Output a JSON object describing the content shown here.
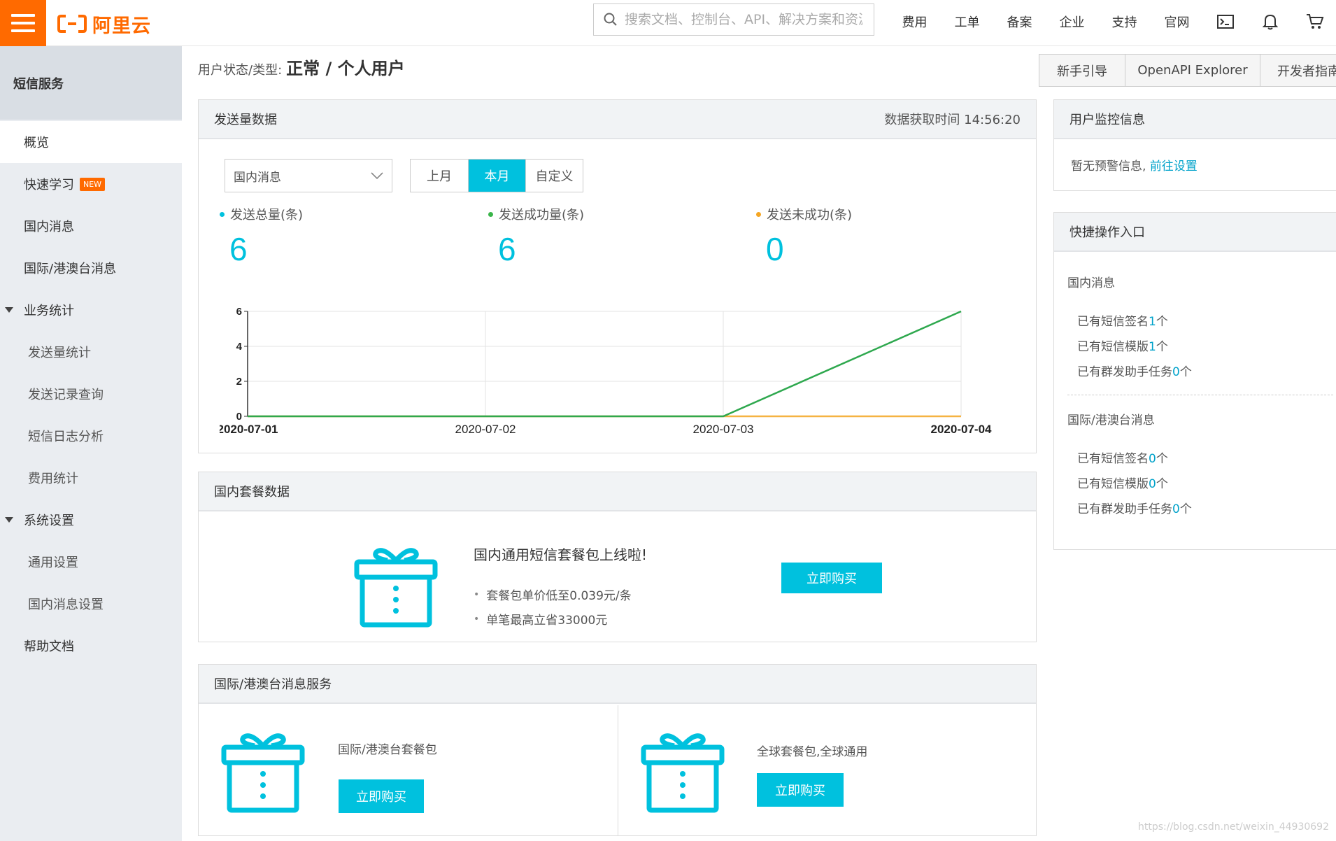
{
  "topbar": {
    "logo_text": "阿里云",
    "search_placeholder": "搜索文档、控制台、API、解决方案和资源",
    "nav": [
      "费用",
      "工单",
      "备案",
      "企业",
      "支持",
      "官网"
    ]
  },
  "sidebar": {
    "title": "短信服务",
    "items": [
      {
        "label": "概览"
      },
      {
        "label": "快速学习",
        "badge": "NEW"
      },
      {
        "label": "国内消息"
      },
      {
        "label": "国际/港澳台消息"
      },
      {
        "label": "业务统计"
      },
      {
        "label": "发送量统计"
      },
      {
        "label": "发送记录查询"
      },
      {
        "label": "短信日志分析"
      },
      {
        "label": "费用统计"
      },
      {
        "label": "系统设置"
      },
      {
        "label": "通用设置"
      },
      {
        "label": "国内消息设置"
      },
      {
        "label": "帮助文档"
      }
    ]
  },
  "user_status": {
    "label": "用户状态/类型:",
    "value": "正常 / 个人用户"
  },
  "guide_buttons": [
    "新手引导",
    "OpenAPI Explorer",
    "开发者指南"
  ],
  "send_panel": {
    "title": "发送量数据",
    "fetch_time": "数据获取时间 14:56:20",
    "select_value": "国内消息",
    "segments": [
      "上月",
      "本月",
      "自定义"
    ],
    "active_segment": "本月",
    "stats": [
      {
        "label": "发送总量(条)",
        "value": "6",
        "color": "#00c1de"
      },
      {
        "label": "发送成功量(条)",
        "value": "6",
        "color": "#3ab54a"
      },
      {
        "label": "发送未成功(条)",
        "value": "0",
        "color": "#f5a623"
      }
    ]
  },
  "chart_data": {
    "type": "line",
    "x": [
      "2020-07-01",
      "2020-07-02",
      "2020-07-03",
      "2020-07-04"
    ],
    "series": [
      {
        "values": [
          0,
          0,
          0,
          6
        ],
        "color": "#2ea84e"
      },
      {
        "values": [
          0,
          0,
          0,
          0
        ],
        "color": "#f5b342"
      }
    ],
    "yticks": [
      0,
      2,
      4,
      6
    ],
    "ylim": [
      0,
      6
    ],
    "grid": true
  },
  "package_panel": {
    "title": "国内套餐数据",
    "promo_title": "国内通用短信套餐包上线啦!",
    "bullets": [
      "套餐包单价低至0.039元/条",
      "单笔最高立省33000元"
    ],
    "buy_label": "立即购买"
  },
  "intl_panel": {
    "title": "国际/港澳台消息服务",
    "cards": [
      {
        "label": "国际/港澳台套餐包",
        "buy_label": "立即购买"
      },
      {
        "label": "全球套餐包,全球通用",
        "buy_label": "立即购买"
      }
    ]
  },
  "monitor_panel": {
    "title": "用户监控信息",
    "text": "暂无预警信息,",
    "link": "前往设置"
  },
  "quick_panel": {
    "title": "快捷操作入口",
    "domestic_title": "国内消息",
    "domestic": [
      {
        "prefix": "已有短信签名",
        "num": "1",
        "suffix": "个"
      },
      {
        "prefix": "已有短信模版",
        "num": "1",
        "suffix": "个"
      },
      {
        "prefix": "已有群发助手任务",
        "num": "0",
        "suffix": "个"
      }
    ],
    "intl_title": "国际/港澳台消息",
    "intl": [
      {
        "prefix": "已有短信签名",
        "num": "0",
        "suffix": "个"
      },
      {
        "prefix": "已有短信模版",
        "num": "0",
        "suffix": "个"
      },
      {
        "prefix": "已有群发助手任务",
        "num": "0",
        "suffix": "个"
      }
    ]
  },
  "watermark": "https://blog.csdn.net/weixin_44930692"
}
